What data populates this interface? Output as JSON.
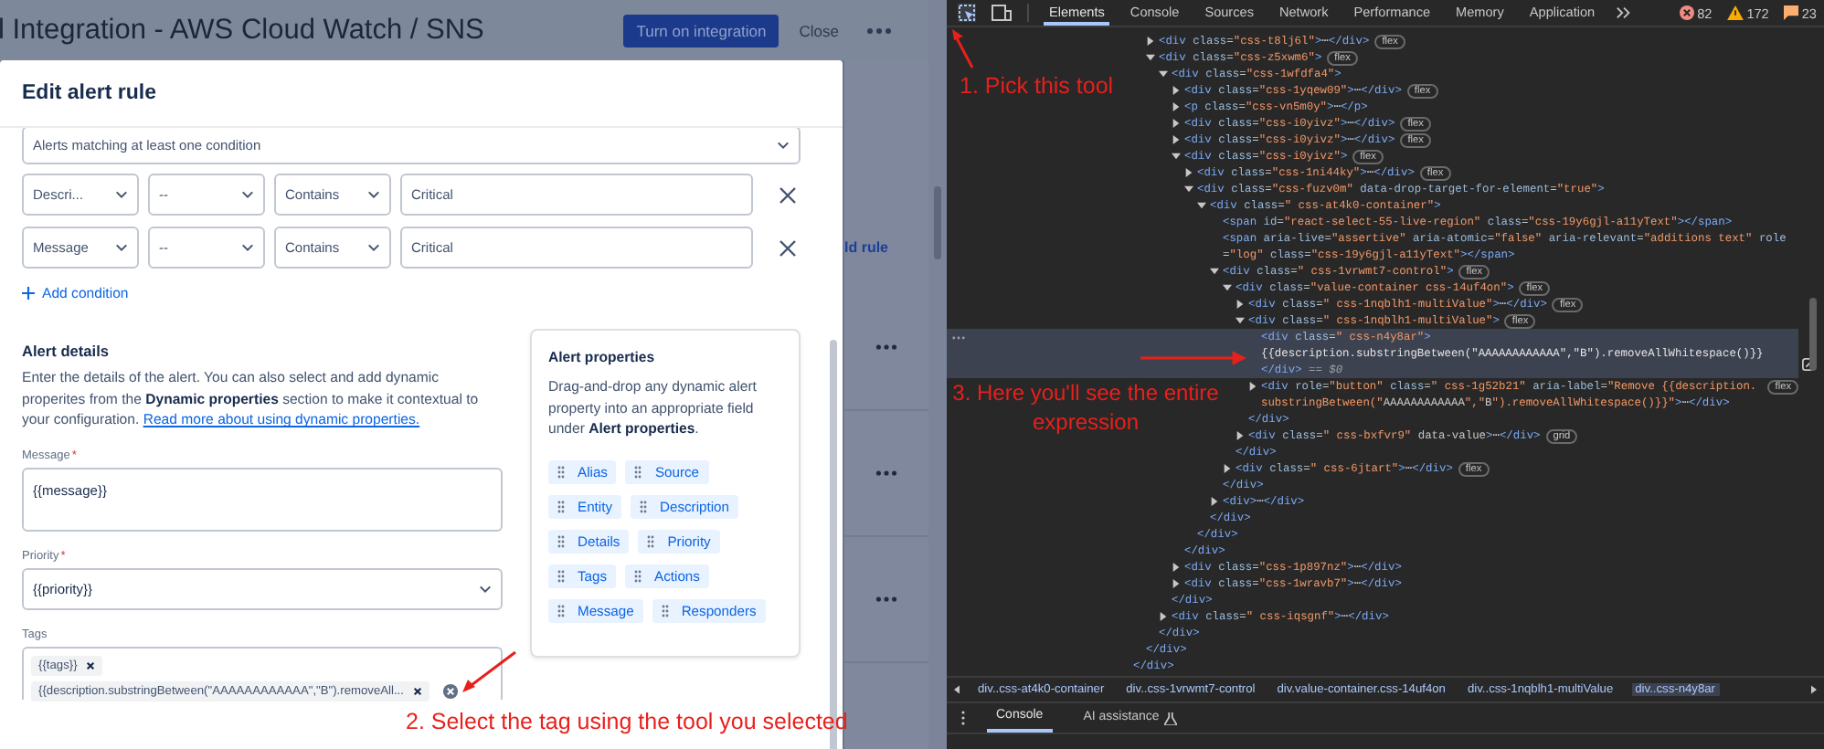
{
  "page": {
    "title": "l Integration - AWS Cloud Watch / SNS",
    "primary_button": "Turn on integration",
    "close_button": "Close",
    "behind_link": "ld rule"
  },
  "modal": {
    "title": "Edit alert rule",
    "match_select": "Alerts matching at least one condition",
    "conditions": [
      {
        "field": "Descri...",
        "operator_prefix": "--",
        "operator": "Contains",
        "value": "Critical"
      },
      {
        "field": "Message",
        "operator_prefix": "--",
        "operator": "Contains",
        "value": "Critical"
      }
    ],
    "add_condition": "Add condition",
    "details_title": "Alert details",
    "details_text": "Enter the details of the alert. You can also select and add dynamic properites from the **Dynamic properties** section to make it contextual to your configuration.",
    "details_link": "Read more about using dynamic properties.",
    "message": {
      "label": "Message",
      "required_mark": "*",
      "value": "{{message}}"
    },
    "priority": {
      "label": "Priority",
      "required_mark": "*",
      "value": "{{priority}}"
    },
    "tags": {
      "label": "Tags",
      "chips": [
        "{{tags}}",
        "{{description.substringBetween(\"AAAAAAAAAAAA\",\"B\").removeAll..."
      ]
    },
    "properties_card": {
      "title": "Alert properties",
      "text": "Drag-and-drop any dynamic alert property into an appropriate field under **Alert properties**.",
      "chips": [
        "Alias",
        "Source",
        "Entity",
        "Description",
        "Details",
        "Priority",
        "Tags",
        "Actions",
        "Message",
        "Responders"
      ]
    }
  },
  "devtools": {
    "tabs": [
      {
        "label": "Elements",
        "selected": true
      },
      {
        "label": "Console",
        "selected": false
      },
      {
        "label": "Sources",
        "selected": false
      },
      {
        "label": "Network",
        "selected": false
      },
      {
        "label": "Performance",
        "selected": false
      },
      {
        "label": "Memory",
        "selected": false
      },
      {
        "label": "Application",
        "selected": false
      }
    ],
    "counts": [
      {
        "kind": "error",
        "value": "82"
      },
      {
        "kind": "warning",
        "value": "172"
      },
      {
        "kind": "info",
        "value": "23"
      }
    ],
    "tree": [
      {
        "kind": "ancestor",
        "close": "</div>",
        "children": [
          {
            "kind": "ancestor",
            "close": "</div>",
            "children": [
              {
                "kind": "element",
                "expanded": false,
                "selected": false,
                "open": "<div class=\"css-t8lj6l\">⋯</div>",
                "badge": "flex"
              },
              {
                "kind": "element",
                "expanded": true,
                "selected": false,
                "open": "<div class=\"css-z5xwm6\">",
                "badge": "flex",
                "close": "</div>",
                "children": [
                  {
                    "kind": "element",
                    "expanded": true,
                    "selected": false,
                    "open": "<div class=\"css-1wfdfa4\">",
                    "close": "</div>",
                    "children": [
                      {
                        "kind": "element",
                        "expanded": false,
                        "selected": false,
                        "open": "<div class=\"css-1yqew09\">⋯</div>",
                        "badge": "flex"
                      },
                      {
                        "kind": "element",
                        "expanded": false,
                        "selected": false,
                        "open": "<p class=\"css-vn5m0y\">⋯</p>"
                      },
                      {
                        "kind": "element",
                        "expanded": false,
                        "selected": false,
                        "open": "<div class=\"css-i0yivz\">⋯</div>",
                        "badge": "flex"
                      },
                      {
                        "kind": "element",
                        "expanded": false,
                        "selected": false,
                        "open": "<div class=\"css-i0yivz\">⋯</div>",
                        "badge": "flex"
                      },
                      {
                        "kind": "element",
                        "expanded": true,
                        "selected": false,
                        "open": "<div class=\"css-i0yivz\">",
                        "badge": "flex",
                        "close": "</div>",
                        "children": [
                          {
                            "kind": "element",
                            "expanded": false,
                            "selected": false,
                            "open": "<div class=\"css-1ni44ky\">⋯</div>",
                            "badge": "flex"
                          },
                          {
                            "kind": "element",
                            "expanded": true,
                            "selected": false,
                            "open": "<div class=\"css-fuzv0m\" data-drop-target-for-element=\"true\">",
                            "close": "</div>",
                            "children": [
                              {
                                "kind": "element",
                                "expanded": true,
                                "selected": false,
                                "open": "<div class=\" css-at4k0-container\">",
                                "close": "</div>",
                                "children": [
                                  {
                                    "kind": "leaf",
                                    "selected": false,
                                    "open": "<span id=\"react-select-55-live-region\" class=\"css-19y6gjl-a11yText\"></span>"
                                  },
                                  {
                                    "kind": "leaf",
                                    "selected": false,
                                    "open": "<span aria-live=\"assertive\" aria-atomic=\"false\" aria-relevant=\"additions text\" role=\"log\" class=\"css-19y6gjl-a11yText\"></span>"
                                  },
                                  {
                                    "kind": "element",
                                    "expanded": true,
                                    "selected": false,
                                    "open": "<div class=\" css-1vrwmt7-control\">",
                                    "badge": "flex",
                                    "close": "</div>",
                                    "children": [
                                      {
                                        "kind": "element",
                                        "expanded": true,
                                        "selected": false,
                                        "open": "<div class=\"value-container css-14uf4on\">",
                                        "badge": "flex",
                                        "close": "</div>",
                                        "children": [
                                          {
                                            "kind": "element",
                                            "expanded": false,
                                            "selected": false,
                                            "open": "<div class=\" css-1nqblh1-multiValue\">⋯</div>",
                                            "badge": "flex"
                                          },
                                          {
                                            "kind": "element",
                                            "expanded": true,
                                            "selected": false,
                                            "open": "<div class=\" css-1nqblh1-multiValue\">",
                                            "badge": "flex",
                                            "close": "</div>",
                                            "children": [
                                              {
                                                "kind": "leaf",
                                                "selected": true,
                                                "open": "<div class=\" css-n4y8ar\">",
                                                "content": "{{description.substringBetween(\"AAAAAAAAAAAA\",\"B\").removeAllWhitespace()}}",
                                                "close": "</div>",
                                                "suffix": "== $0"
                                              },
                                              {
                                                "kind": "element",
                                                "expanded": false,
                                                "selected": false,
                                                "open": "<div role=\"button\" class=\" css-1g52b21\" aria-label=\"Remove {{description.substringBetween(\"AAAAAAAAAAAA\",\"B\").removeAllWhitespace()}}\">⋯</div>",
                                                "badge": "flex"
                                              }
                                            ]
                                          },
                                          {
                                            "kind": "element",
                                            "expanded": false,
                                            "selected": false,
                                            "open": "<div class=\" css-bxfvr9\" data-value>⋯</div>",
                                            "badge": "grid"
                                          }
                                        ]
                                      },
                                      {
                                        "kind": "element",
                                        "expanded": false,
                                        "selected": false,
                                        "open": "<div class=\" css-6jtart\">⋯</div>",
                                        "badge": "flex"
                                      }
                                    ]
                                  },
                                  {
                                    "kind": "element",
                                    "expanded": false,
                                    "selected": false,
                                    "open": "<div>⋯</div>"
                                  }
                                ]
                              }
                            ]
                          }
                        ]
                      },
                      {
                        "kind": "element",
                        "expanded": false,
                        "selected": false,
                        "open": "<div class=\"css-1p897nz\">⋯</div>"
                      },
                      {
                        "kind": "element",
                        "expanded": false,
                        "selected": false,
                        "open": "<div class=\"css-1wravb7\">⋯</div>"
                      }
                    ]
                  },
                  {
                    "kind": "element",
                    "expanded": false,
                    "selected": false,
                    "open": "<div class=\" css-iqsgnf\">⋯</div>"
                  }
                ]
              }
            ]
          }
        ]
      }
    ],
    "breadcrumbs": [
      {
        "label": "div..css-at4k0-container",
        "selected": false
      },
      {
        "label": "div..css-1vrwmt7-control",
        "selected": false
      },
      {
        "label": "div.value-container.css-14uf4on",
        "selected": false
      },
      {
        "label": "div..css-1nqblh1-multiValue",
        "selected": false
      },
      {
        "label": "div..css-n4y8ar",
        "selected": true
      }
    ],
    "drawer_tabs": [
      {
        "label": "Console",
        "selected": true
      },
      {
        "label": "AI assistance",
        "selected": false
      }
    ]
  },
  "annotations": [
    {
      "text": "1. Pick this tool"
    },
    {
      "text": "2. Select the tag using the tool you selected"
    },
    {
      "text": "3. Here you'll see the entire expression"
    }
  ]
}
